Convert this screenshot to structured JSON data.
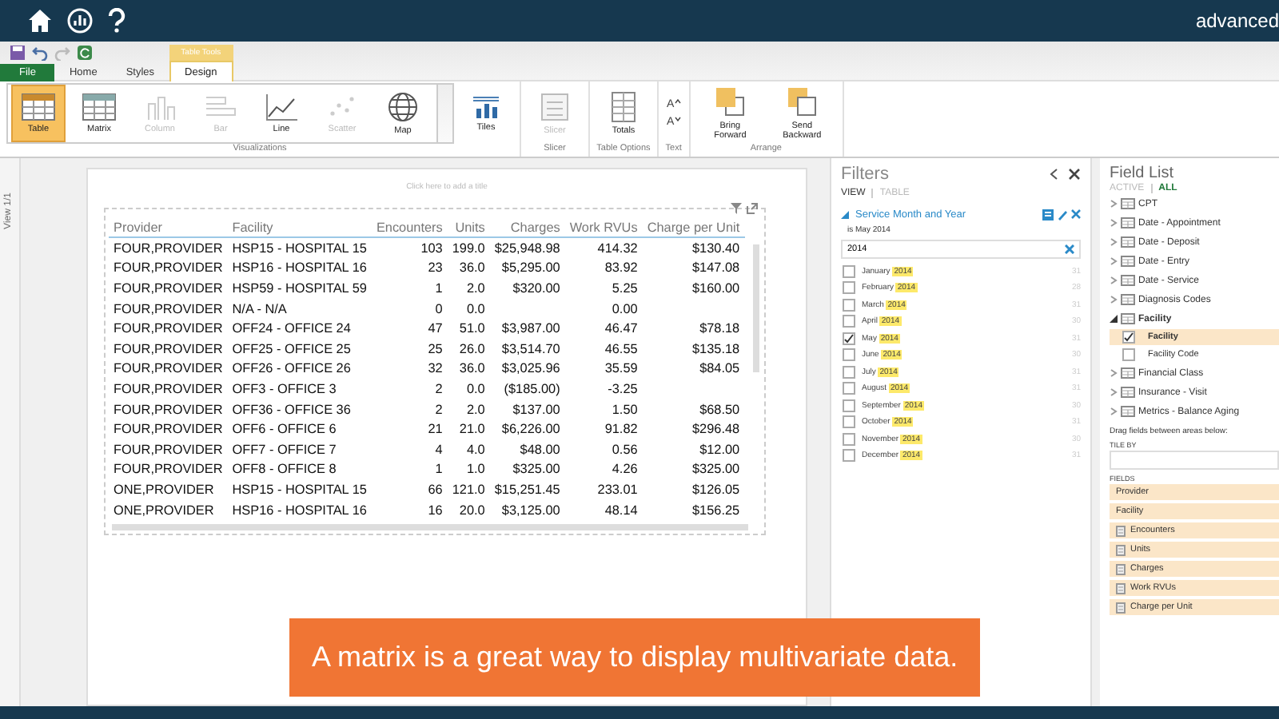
{
  "app_bar": {
    "brand": "advanced"
  },
  "contextual_tab_label": "Table Tools",
  "tabs": [
    {
      "label": "File",
      "kind": "file",
      "selected": false
    },
    {
      "label": "Home",
      "kind": "normal",
      "selected": false
    },
    {
      "label": "Styles",
      "kind": "normal",
      "selected": false
    },
    {
      "label": "Design",
      "kind": "contextual",
      "selected": true
    }
  ],
  "ribbon": {
    "groups": [
      {
        "label": "Visualizations",
        "kind": "gallery",
        "buttons": [
          {
            "label": "Table",
            "kind": "table",
            "selected": true,
            "disabled": false
          },
          {
            "label": "Matrix",
            "kind": "matrix",
            "selected": false,
            "disabled": false
          },
          {
            "label": "Column",
            "kind": "column",
            "selected": false,
            "disabled": true
          },
          {
            "label": "Bar",
            "kind": "bar",
            "selected": false,
            "disabled": true
          },
          {
            "label": "Line",
            "kind": "line",
            "selected": false,
            "disabled": false
          },
          {
            "label": "Scatter",
            "kind": "scatter",
            "selected": false,
            "disabled": true
          },
          {
            "label": "Map",
            "kind": "map",
            "selected": false,
            "disabled": false
          }
        ],
        "extra": [
          {
            "label": "Tiles",
            "kind": "tiles",
            "disabled": false
          }
        ]
      },
      {
        "label": "Slicer",
        "kind": "plain",
        "buttons": [
          {
            "label": "Slicer",
            "kind": "slicer",
            "selected": false,
            "disabled": true
          }
        ]
      },
      {
        "label": "Table Options",
        "kind": "plain",
        "buttons": [
          {
            "label": "Totals",
            "kind": "totals",
            "selected": false,
            "disabled": false
          }
        ]
      },
      {
        "label": "Text",
        "kind": "text",
        "buttons": [
          {
            "label": "A",
            "kind": "grow_font",
            "selected": false,
            "disabled": false
          },
          {
            "label": "A",
            "kind": "shrink_font",
            "selected": false,
            "disabled": false
          }
        ]
      },
      {
        "label": "Arrange",
        "kind": "plain",
        "buttons": [
          {
            "label": "Bring Forward",
            "kind": "forward",
            "selected": false,
            "disabled": false
          },
          {
            "label": "Send Backward",
            "kind": "backward",
            "selected": false,
            "disabled": false
          }
        ]
      }
    ]
  },
  "side_strip": {
    "label": "View 1/1"
  },
  "canvas": {
    "title_placeholder": "Click here to add a title",
    "table": {
      "columns": [
        {
          "label": "Provider"
        },
        {
          "label": "Facility"
        },
        {
          "label": "Encounters"
        },
        {
          "label": "Units"
        },
        {
          "label": "Charges"
        },
        {
          "label": "Work RVUs"
        },
        {
          "label": "Charge per Unit"
        }
      ],
      "rows": [
        [
          "FOUR,PROVIDER",
          "HSP15 - HOSPITAL 15",
          "103",
          "199.0",
          "$25,948.98",
          "414.32",
          "$130.40"
        ],
        [
          "FOUR,PROVIDER",
          "HSP16 - HOSPITAL 16",
          "23",
          "36.0",
          "$5,295.00",
          "83.92",
          "$147.08"
        ],
        [
          "FOUR,PROVIDER",
          "HSP59 - HOSPITAL 59",
          "1",
          "2.0",
          "$320.00",
          "5.25",
          "$160.00"
        ],
        [
          "FOUR,PROVIDER",
          "N/A - N/A",
          "0",
          "0.0",
          "",
          "0.00",
          ""
        ],
        [
          "FOUR,PROVIDER",
          "OFF24 - OFFICE 24",
          "47",
          "51.0",
          "$3,987.00",
          "46.47",
          "$78.18"
        ],
        [
          "FOUR,PROVIDER",
          "OFF25 - OFFICE 25",
          "25",
          "26.0",
          "$3,514.70",
          "46.55",
          "$135.18"
        ],
        [
          "FOUR,PROVIDER",
          "OFF26 - OFFICE 26",
          "32",
          "36.0",
          "$3,025.96",
          "35.59",
          "$84.05"
        ],
        [
          "FOUR,PROVIDER",
          "OFF3 - OFFICE 3",
          "2",
          "0.0",
          "($185.00)",
          "-3.25",
          ""
        ],
        [
          "FOUR,PROVIDER",
          "OFF36 - OFFICE 36",
          "2",
          "2.0",
          "$137.00",
          "1.50",
          "$68.50"
        ],
        [
          "FOUR,PROVIDER",
          "OFF6 - OFFICE 6",
          "21",
          "21.0",
          "$6,226.00",
          "91.82",
          "$296.48"
        ],
        [
          "FOUR,PROVIDER",
          "OFF7 - OFFICE 7",
          "4",
          "4.0",
          "$48.00",
          "0.56",
          "$12.00"
        ],
        [
          "FOUR,PROVIDER",
          "OFF8 - OFFICE 8",
          "1",
          "1.0",
          "$325.00",
          "4.26",
          "$325.00"
        ],
        [
          "ONE,PROVIDER",
          "HSP15 - HOSPITAL 15",
          "66",
          "121.0",
          "$15,251.45",
          "233.01",
          "$126.05"
        ],
        [
          "ONE,PROVIDER",
          "HSP16 - HOSPITAL 16",
          "16",
          "20.0",
          "$3,125.00",
          "48.14",
          "$156.25"
        ]
      ]
    }
  },
  "filters": {
    "title": "Filters",
    "tabs": [
      {
        "label": "VIEW",
        "selected": true
      },
      {
        "label": "TABLE",
        "selected": false
      }
    ],
    "field": {
      "label": "Service Month and Year",
      "summary": "is May 2014"
    },
    "search": {
      "value": "2014"
    },
    "items": [
      {
        "month": "January",
        "match": "2014",
        "count": "31",
        "checked": false
      },
      {
        "month": "February",
        "match": "2014",
        "count": "28",
        "checked": false
      },
      {
        "month": "March",
        "match": "2014",
        "count": "31",
        "checked": false
      },
      {
        "month": "April",
        "match": "2014",
        "count": "30",
        "checked": false
      },
      {
        "month": "May",
        "match": "2014",
        "count": "31",
        "checked": true
      },
      {
        "month": "June",
        "match": "2014",
        "count": "30",
        "checked": false
      },
      {
        "month": "July",
        "match": "2014",
        "count": "31",
        "checked": false
      },
      {
        "month": "August",
        "match": "2014",
        "count": "31",
        "checked": false
      },
      {
        "month": "September",
        "match": "2014",
        "count": "30",
        "checked": false
      },
      {
        "month": "October",
        "match": "2014",
        "count": "31",
        "checked": false
      },
      {
        "month": "November",
        "match": "2014",
        "count": "30",
        "checked": false
      },
      {
        "month": "December",
        "match": "2014",
        "count": "31",
        "checked": false
      }
    ]
  },
  "field_list": {
    "title": "Field List",
    "tabs": [
      {
        "label": "ACTIVE",
        "selected": false
      },
      {
        "label": "ALL",
        "selected": true
      }
    ],
    "tables": [
      {
        "label": "CPT",
        "expanded": false
      },
      {
        "label": "Date - Appointment",
        "expanded": false
      },
      {
        "label": "Date - Deposit",
        "expanded": false
      },
      {
        "label": "Date - Entry",
        "expanded": false
      },
      {
        "label": "Date - Service",
        "expanded": false
      },
      {
        "label": "Diagnosis Codes",
        "expanded": false
      },
      {
        "label": "Facility",
        "expanded": true,
        "children": [
          {
            "label": "Facility",
            "checked": true
          },
          {
            "label": "Facility Code",
            "checked": false
          }
        ]
      },
      {
        "label": "Financial Class",
        "expanded": false
      },
      {
        "label": "Insurance - Visit",
        "expanded": false
      },
      {
        "label": "Metrics - Balance Aging",
        "expanded": false
      }
    ],
    "hint": "Drag fields between areas below:",
    "tile_by_label": "TILE BY",
    "fields_label": "FIELDS",
    "fields": [
      {
        "label": "Provider",
        "kind": "category"
      },
      {
        "label": "Facility",
        "kind": "category"
      },
      {
        "label": "Encounters",
        "kind": "measure"
      },
      {
        "label": "Units",
        "kind": "measure"
      },
      {
        "label": "Charges",
        "kind": "measure"
      },
      {
        "label": "Work RVUs",
        "kind": "measure"
      },
      {
        "label": "Charge per Unit",
        "kind": "measure"
      }
    ]
  },
  "caption": "A matrix is a great way to display multivariate data."
}
